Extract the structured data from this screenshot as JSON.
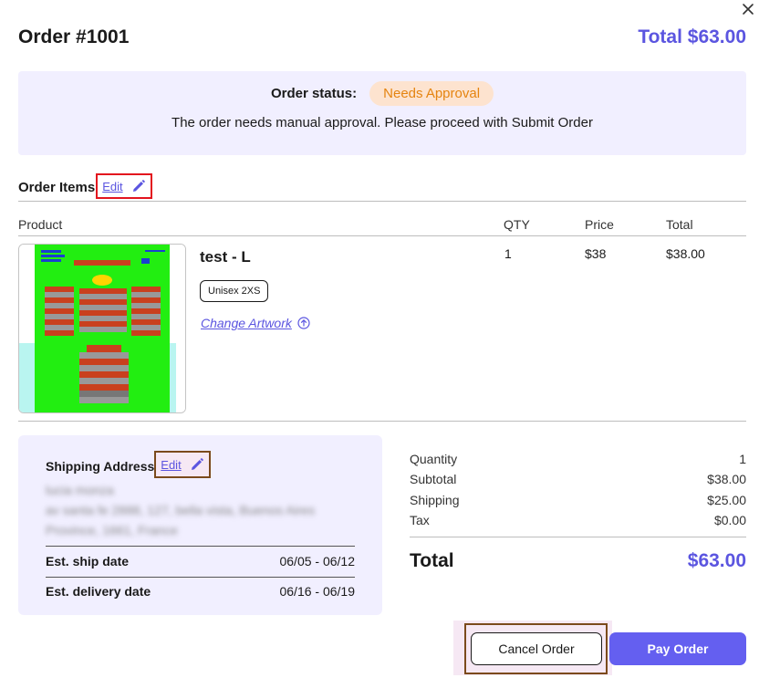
{
  "order": {
    "title": "Order #1001",
    "total_header": "Total $63.00"
  },
  "status": {
    "label": "Order status:",
    "badge": "Needs Approval",
    "message": "The order needs manual approval. Please proceed with Submit Order",
    "badge_bg": "#fde3cf",
    "badge_color": "#e58410"
  },
  "items": {
    "title": "Order Items",
    "edit_label": "Edit",
    "columns": [
      "Product",
      "QTY",
      "Price",
      "Total"
    ],
    "rows": [
      {
        "name": "test - L",
        "size": "Unisex 2XS",
        "change_artwork": "Change Artwork",
        "qty": "1",
        "price": "$38",
        "total": "$38.00"
      }
    ]
  },
  "shipping": {
    "title": "Shipping Address",
    "edit_label": "Edit",
    "address_lines": [
      "lucia monza",
      "av santa fe 2888, 127, bella vista, Buenos Aires",
      "Province, 1661, France"
    ],
    "ship_date_label": "Est. ship date",
    "ship_date_value": "06/05 - 06/12",
    "delivery_date_label": "Est. delivery date",
    "delivery_date_value": "06/16 - 06/19"
  },
  "summary": {
    "rows": [
      {
        "label": "Quantity",
        "value": "1"
      },
      {
        "label": "Subtotal",
        "value": "$38.00"
      },
      {
        "label": "Shipping",
        "value": "$25.00"
      },
      {
        "label": "Tax",
        "value": "$0.00"
      }
    ],
    "total_label": "Total",
    "total_value": "$63.00"
  },
  "actions": {
    "cancel_label": "Cancel Order",
    "pay_label": "Pay Order"
  },
  "colors": {
    "accent": "#5b55e0",
    "panel_bg": "#f1efff",
    "highlight_red": "#e3141e",
    "highlight_brown": "#7b4a1c"
  },
  "icons": {
    "close": "close-icon",
    "pencil": "pencil-icon",
    "upload": "upload-circle-icon"
  }
}
